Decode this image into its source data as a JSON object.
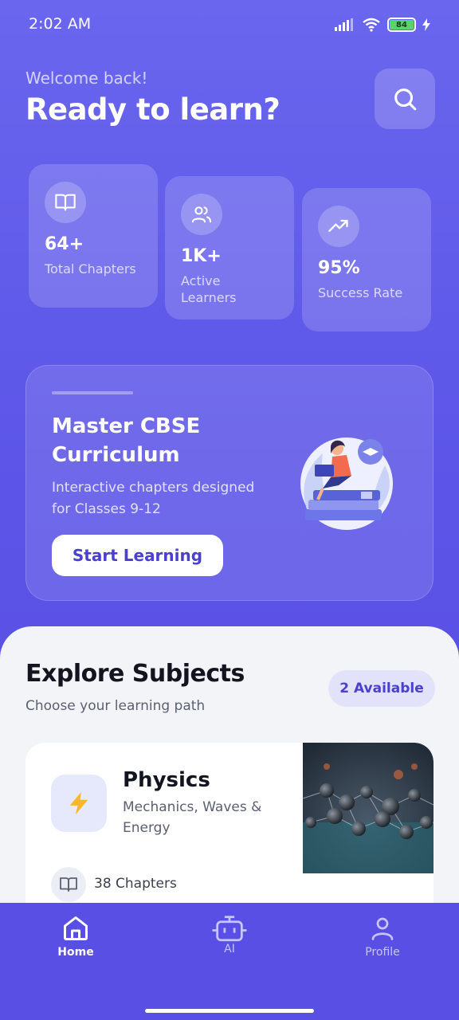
{
  "status_bar": {
    "time": "2:02 AM",
    "battery": "84"
  },
  "header": {
    "greeting": "Welcome back!",
    "headline": "Ready to learn?",
    "search_icon": "search-icon"
  },
  "stats": [
    {
      "icon": "book-icon",
      "value": "64+",
      "label": "Total Chapters"
    },
    {
      "icon": "users-icon",
      "value": "1K+",
      "label": "Active Learners"
    },
    {
      "icon": "trending-up-icon",
      "value": "95%",
      "label": "Success Rate"
    }
  ],
  "hero": {
    "title": "Master CBSE Curriculum",
    "subtitle": "Interactive chapters designed for Classes 9-12",
    "button": "Start Learning"
  },
  "explore": {
    "title": "Explore Subjects",
    "subtitle": "Choose your learning path",
    "badge": "2 Available"
  },
  "subjects": [
    {
      "icon": "lightning-icon",
      "name": "Physics",
      "description": "Mechanics, Waves & Energy",
      "chapters": "38 Chapters"
    }
  ],
  "nav": [
    {
      "icon": "home-icon",
      "label": "Home",
      "active": true
    },
    {
      "icon": "robot-icon",
      "label": "AI",
      "active": false
    },
    {
      "icon": "profile-icon",
      "label": "Profile",
      "active": false
    }
  ],
  "colors": {
    "primary": "#5a4fe4",
    "accent_text": "#4b3fcf",
    "sheet": "#f3f4f8"
  }
}
